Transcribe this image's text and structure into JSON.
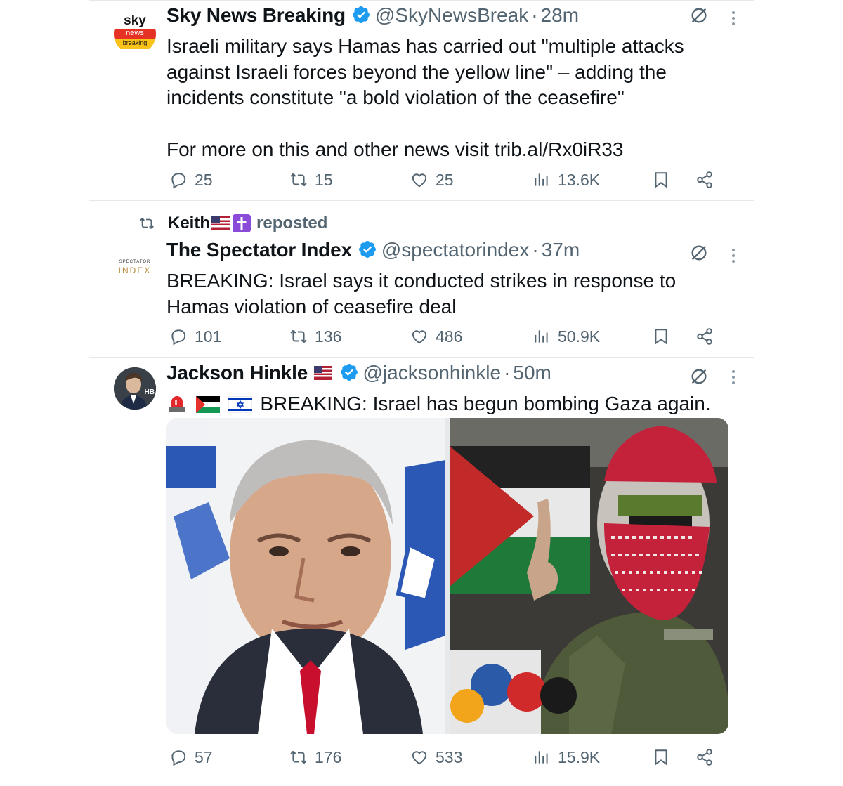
{
  "tweets": [
    {
      "display_name": "Sky News Breaking",
      "handle": "@SkyNewsBreak",
      "dot": "·",
      "time": "28m",
      "avatar_text": {
        "line1": "sky",
        "line2": "news",
        "line3": "breaking"
      },
      "text_lines": [
        "Israeli military says Hamas has carried out \"multiple attacks",
        "against Israeli forces beyond the yellow line\" – adding the",
        "incidents constitute \"a bold violation of the ceasefire\""
      ],
      "text_more": "For more on this and other news visit trib.al/Rx0iR33",
      "replies": "25",
      "reposts": "15",
      "likes": "25",
      "views": "13.6K"
    },
    {
      "repost_by": "Keith",
      "repost_suffix": "reposted",
      "display_name": "The Spectator Index",
      "handle": "@spectatorindex",
      "dot": "·",
      "time": "37m",
      "avatar_text": {
        "line1": "SPECTATOR",
        "line2": "INDEX"
      },
      "text_lines": [
        "BREAKING: Israel says it conducted strikes in response to",
        "Hamas violation of ceasefire deal"
      ],
      "replies": "101",
      "reposts": "136",
      "likes": "486",
      "views": "50.9K"
    },
    {
      "display_name": "Jackson Hinkle",
      "handle": "@jacksonhinkle",
      "dot": "·",
      "time": "50m",
      "avatar_text": {
        "badge": "HB"
      },
      "text": "BREAKING: Israel has begun bombing Gaza again.",
      "replies": "57",
      "reposts": "176",
      "likes": "533",
      "views": "15.9K"
    }
  ],
  "colors": {
    "text": "#0f1419",
    "secondary": "#536471",
    "verified": "#1d9bf0",
    "divider": "#e6e9ec"
  },
  "icons": [
    "reply-icon",
    "repost-icon",
    "like-icon",
    "views-icon",
    "bookmark-icon",
    "share-icon",
    "grok-icon",
    "more-icon",
    "verified-icon"
  ]
}
